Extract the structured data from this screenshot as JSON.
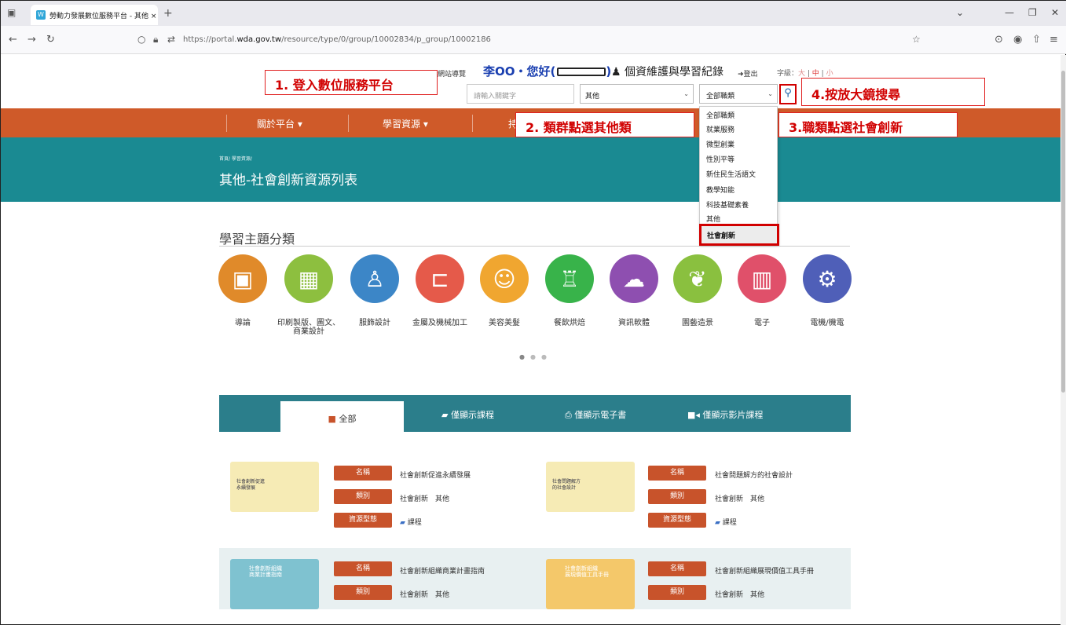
{
  "browser": {
    "tab_title": "勞動力發展數位服務平台 - 其他 ×",
    "url_prefix": "https://portal.",
    "url_host": "wda.gov.tw",
    "url_path": "/resource/type/0/group/10002834/p_group/10002186"
  },
  "header": {
    "site_guide": "網站導覽",
    "greeting": "李OO・您好(",
    "greeting_close": ")",
    "privacy_link": "♟ 個資維護與學習紀錄",
    "logout": "➜登出",
    "font_size_label": "字級：",
    "font_big": "大",
    "font_mid": "中",
    "font_small": "小",
    "keyword_placeholder": "請輸入關鍵字",
    "group_select": "其他",
    "job_select": "全部職類"
  },
  "menu": [
    {
      "label": "關於平台 ▾"
    },
    {
      "label": "學習資源 ▾"
    },
    {
      "label": "持"
    }
  ],
  "page": {
    "breadcrumb": "首頁/ 學習資源/",
    "title": "其他-社會創新資源列表"
  },
  "topics": {
    "section_title": "學習主題分類",
    "items": [
      {
        "label": "導論",
        "color": "#e08a2a",
        "icon": "book-icon"
      },
      {
        "label": "印刷製版、圖文、商業設計",
        "color": "#8dbf3f",
        "icon": "palette-icon"
      },
      {
        "label": "服飾設計",
        "color": "#3c86c7",
        "icon": "dress-form-icon"
      },
      {
        "label": "金屬及機械加工",
        "color": "#e55a4a",
        "icon": "clamp-icon"
      },
      {
        "label": "美容美髮",
        "color": "#f0a630",
        "icon": "hair-icon"
      },
      {
        "label": "餐飲烘焙",
        "color": "#38b34a",
        "icon": "chef-hat-icon"
      },
      {
        "label": "資訊軟體",
        "color": "#8e4fb0",
        "icon": "server-icon"
      },
      {
        "label": "園藝造景",
        "color": "#8ac03f",
        "icon": "wheat-icon"
      },
      {
        "label": "電子",
        "color": "#e0506a",
        "icon": "chip-icon"
      },
      {
        "label": "電機/機電",
        "color": "#4f5fb8",
        "icon": "gears-icon"
      }
    ]
  },
  "filters": {
    "all": "全部",
    "course": "僅顯示課程",
    "ebook": "僅顯示電子書",
    "video": "僅顯示影片課程"
  },
  "labels": {
    "name": "名稱",
    "category": "類別",
    "type": "資源型態"
  },
  "resources": [
    {
      "name": "社會創新促進永續發展",
      "category": "社會創新　其他",
      "type": "課程",
      "thumb_text": "社會創新促進\n永續發展"
    },
    {
      "name": "社會問題解方的社會設計",
      "category": "社會創新　其他",
      "type": "課程",
      "thumb_text": "社會問題解方\n的社會設計"
    },
    {
      "name": "社會創新組織商業計畫指南",
      "category": "社會創新　其他",
      "thumb_text": "社會創新組織\n商業計畫指南"
    },
    {
      "name": "社會創新組織展現價值工具手冊",
      "category": "社會創新　其他",
      "thumb_text": "社會創新組織\n展現價值工具手冊"
    }
  ],
  "dropdown": {
    "items": [
      "全部職類",
      "就業服務",
      "微型創業",
      "性別平等",
      "新住民生活語文",
      "教學知能",
      "科技基礎素養",
      "其他"
    ],
    "selected": "社會創新"
  },
  "annotations": {
    "step1": "1. 登入數位服務平台",
    "step2": "2. 類群點選其他類",
    "step3": "3.職類點選社會創新",
    "step4": "4.按放大鏡搜尋"
  },
  "colors": {
    "orange_nav": "#cf5a29",
    "teal_banner": "#1a8a92",
    "annotation_red": "#d10000"
  }
}
